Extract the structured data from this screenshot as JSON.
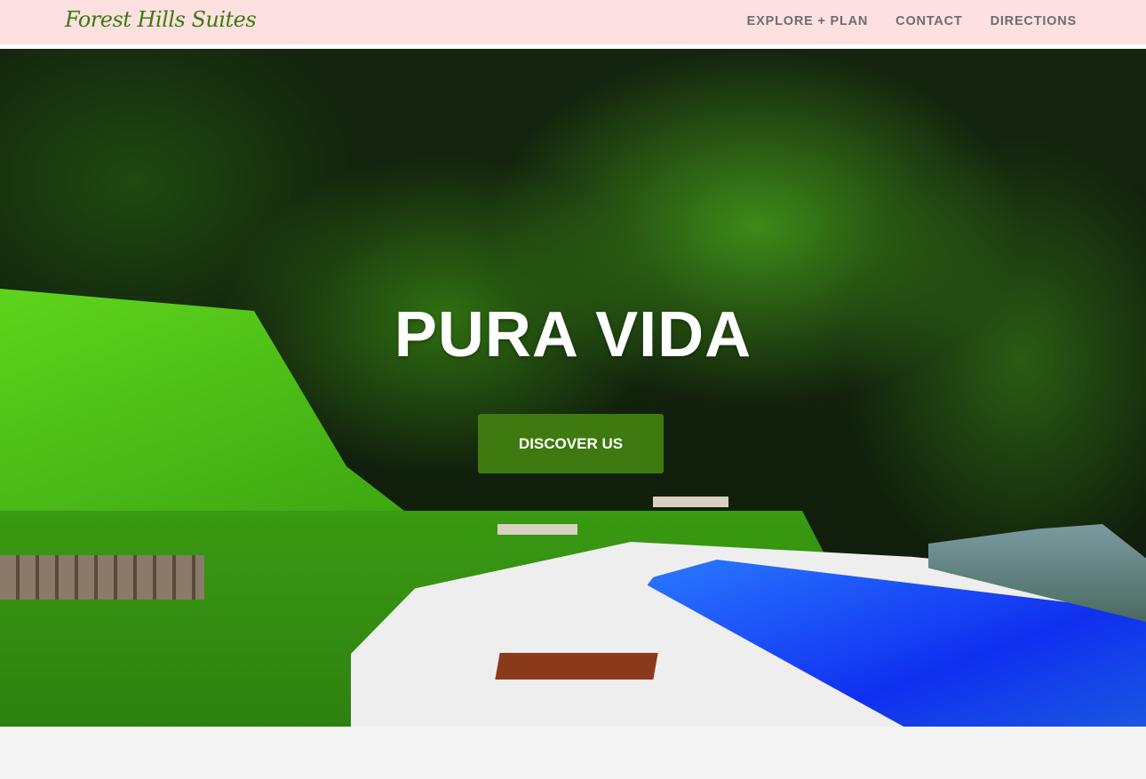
{
  "header": {
    "logo": "Forest Hills Suites",
    "nav": [
      "EXPLORE + PLAN",
      "CONTACT",
      "DIRECTIONS"
    ]
  },
  "hero": {
    "title": "PURA VIDA",
    "button_label": "DISCOVER US"
  },
  "colors": {
    "header_bg": "#fde0e0",
    "logo": "#3d7a10",
    "button": "#3f7a10",
    "nav_text": "#6e6e6e"
  }
}
